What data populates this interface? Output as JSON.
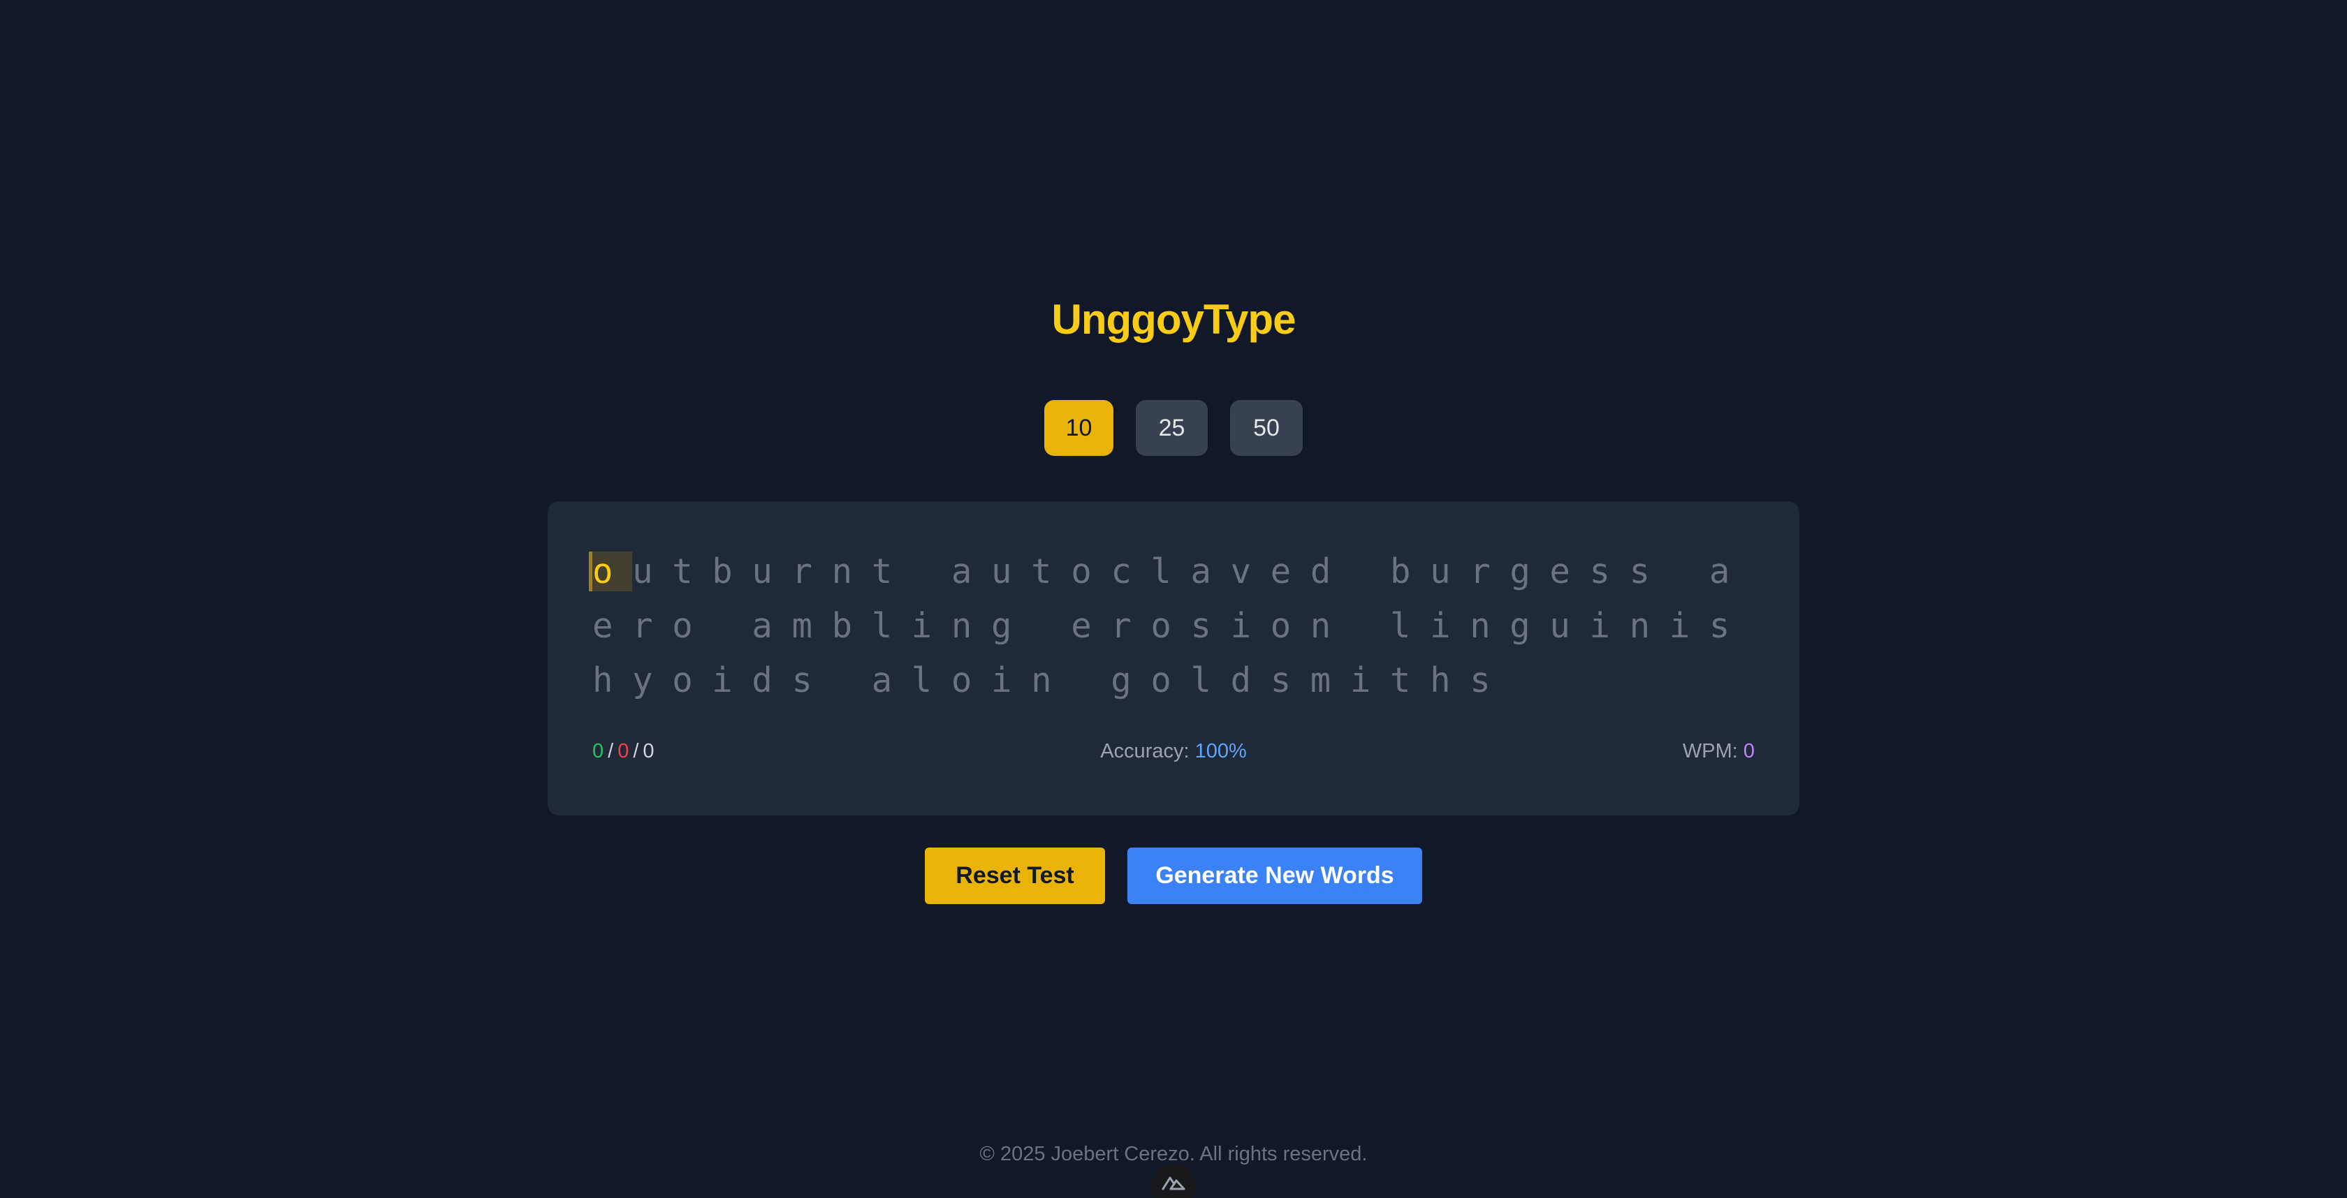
{
  "app": {
    "title": "UnggoyType"
  },
  "word_count_options": {
    "selected": "10",
    "items": [
      "10",
      "25",
      "50"
    ]
  },
  "typing_test": {
    "caret_char": "o",
    "remaining_text": "utburnt autoclaved burgess aero ambling erosion linguinis hyoids aloin goldsmiths"
  },
  "stats": {
    "correct": "0",
    "incorrect": "0",
    "total": "0",
    "separator": "/",
    "accuracy_label": "Accuracy:",
    "accuracy_value": "100%",
    "wpm_label": "WPM:",
    "wpm_value": "0"
  },
  "actions": {
    "reset_label": "Reset Test",
    "generate_label": "Generate New Words"
  },
  "footer": {
    "copyright": "© 2025 Joebert Cerezo. All rights reserved."
  },
  "colors": {
    "background": "#111827",
    "card": "#1f2937",
    "accent_yellow": "#eab308",
    "title_yellow": "#facc15",
    "primary_blue": "#3b82f6",
    "correct_green": "#22c55e",
    "incorrect_red": "#ef4444",
    "accuracy_blue": "#60a5fa",
    "wpm_purple": "#c084fc",
    "untyped_gray": "#6b7280"
  },
  "icons": {
    "devtools_badge": "nuxt-logo-icon"
  }
}
